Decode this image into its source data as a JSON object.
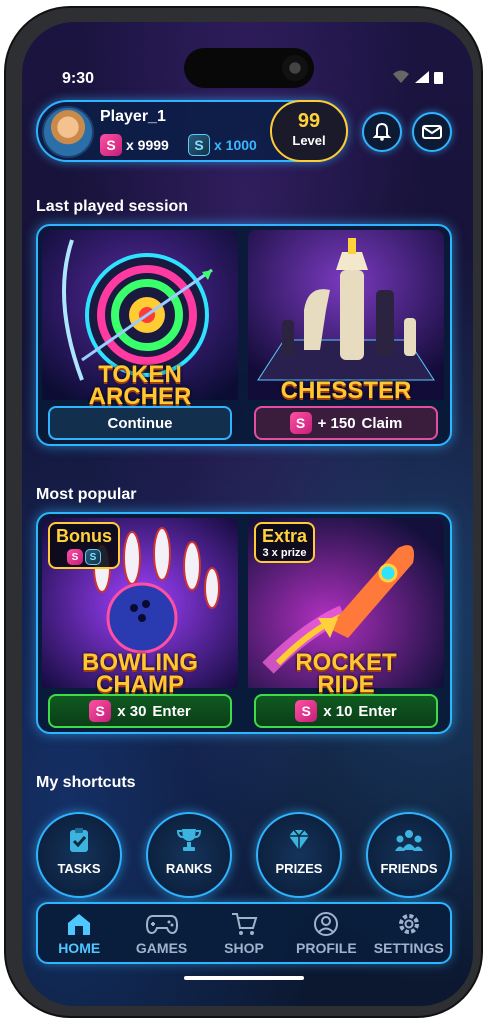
{
  "status": {
    "time": "9:30"
  },
  "profile": {
    "name": "Player_1",
    "pink_tokens": "x 9999",
    "blue_tokens": "x 1000",
    "level_number": "99",
    "level_label": "Level"
  },
  "sections": {
    "last_played": "Last played session",
    "most_popular": "Most popular",
    "shortcuts": "My shortcuts"
  },
  "last_played": [
    {
      "title_line1": "TOKEN",
      "title_line2": "ARCHER",
      "button": "Continue"
    },
    {
      "title_line1": "CHESSTER",
      "button_amount": "+ 150",
      "button_action": "Claim"
    }
  ],
  "popular": [
    {
      "badge": "Bonus",
      "title_line1": "BOWLING",
      "title_line2": "CHAMP",
      "button_amount": "x 30",
      "button_action": "Enter"
    },
    {
      "badge": "Extra",
      "badge_sub": "3 x prize",
      "title_line1": "ROCKET",
      "title_line2": "RIDE",
      "button_amount": "x 10",
      "button_action": "Enter"
    }
  ],
  "shortcuts": [
    {
      "label": "TASKS",
      "icon": "clipboard-icon"
    },
    {
      "label": "RANKS",
      "icon": "trophy-icon"
    },
    {
      "label": "PRIZES",
      "icon": "diamond-icon"
    },
    {
      "label": "FRIENDS",
      "icon": "friends-icon"
    }
  ],
  "nav": [
    {
      "label": "HOME",
      "icon": "home-icon",
      "active": true
    },
    {
      "label": "GAMES",
      "icon": "gamepad-icon"
    },
    {
      "label": "SHOP",
      "icon": "cart-icon"
    },
    {
      "label": "PROFILE",
      "icon": "user-icon"
    },
    {
      "label": "SETTINGS",
      "icon": "gear-icon"
    }
  ],
  "colors": {
    "accent": "#2fb4ff",
    "gold": "#ffc833",
    "pink": "#e24fa0",
    "green": "#3edc4a"
  }
}
